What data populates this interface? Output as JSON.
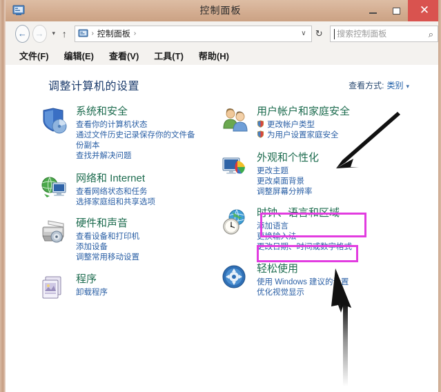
{
  "window": {
    "title": "控制面板",
    "icon": "control-panel-icon",
    "buttons": {
      "minimize": "–",
      "maximize": "□",
      "close": "✕"
    }
  },
  "addressbar": {
    "back": "←",
    "forward": "→",
    "history_caret": "▾",
    "up": "↑",
    "breadcrumb": {
      "icon": "control-panel-icon",
      "sep1": "›",
      "item": "控制面板",
      "sep2": "›"
    },
    "dropdown": "∨",
    "refresh": "↻"
  },
  "search": {
    "placeholder": "搜索控制面板",
    "value": "",
    "icon": "search-icon"
  },
  "menu": {
    "items": [
      {
        "label": "文件(F)"
      },
      {
        "label": "编辑(E)"
      },
      {
        "label": "查看(V)"
      },
      {
        "label": "工具(T)"
      },
      {
        "label": "帮助(H)"
      }
    ]
  },
  "page": {
    "heading": "调整计算机的设置",
    "viewby_label": "查看方式:",
    "viewby_value": "类别",
    "viewby_caret": "▾"
  },
  "categories": {
    "left": [
      {
        "icon": "shield-disk-icon",
        "title": "系统和安全",
        "links": [
          {
            "text": "查看你的计算机状态"
          },
          {
            "text": "通过文件历史记录保存你的文件备"
          },
          {
            "text": "份副本"
          },
          {
            "text": "查找并解决问题"
          }
        ]
      },
      {
        "icon": "globe-monitor-icon",
        "title": "网络和 Internet",
        "links": [
          {
            "text": "查看网络状态和任务"
          },
          {
            "text": "选择家庭组和共享选项"
          }
        ]
      },
      {
        "icon": "printer-icon",
        "title": "硬件和声音",
        "links": [
          {
            "text": "查看设备和打印机"
          },
          {
            "text": "添加设备"
          },
          {
            "text": "调整常用移动设置"
          }
        ]
      },
      {
        "icon": "programs-icon",
        "title": "程序",
        "links": [
          {
            "text": "卸载程序"
          }
        ]
      }
    ],
    "right": [
      {
        "icon": "users-icon",
        "title": "用户帐户和家庭安全",
        "links": [
          {
            "text": "更改帐户类型",
            "shield": true
          },
          {
            "text": "为用户设置家庭安全",
            "shield": true
          }
        ]
      },
      {
        "icon": "display-color-icon",
        "title": "外观和个性化",
        "links": [
          {
            "text": "更改主题"
          },
          {
            "text": "更改桌面背景"
          },
          {
            "text": "调整屏幕分辨率"
          }
        ]
      },
      {
        "icon": "clock-globe-icon",
        "title": "时钟、语言和区域",
        "links": [
          {
            "text": "添加语言"
          },
          {
            "text": "更换输入法"
          },
          {
            "text": "更改日期、时间或数字格式"
          }
        ]
      },
      {
        "icon": "ease-of-access-icon",
        "title": "轻松使用",
        "links": [
          {
            "text": "使用 Windows 建议的设置"
          },
          {
            "text": "优化视觉显示"
          }
        ]
      }
    ]
  },
  "annotations": {
    "highlight_color": "#e23ce0",
    "arrow_color": "#111111",
    "highlight_1_target": "时钟、语言和区域",
    "highlight_2_target": "更换输入法",
    "arrow_1_target": "外观和个性化",
    "arrow_2_target": "更换输入法"
  },
  "colors": {
    "titlebar": "#d3ac90",
    "close_button": "#d9534f",
    "category_title": "#1c6b4e",
    "category_link": "#2a5fa5",
    "page_heading": "#1a3a6b"
  }
}
